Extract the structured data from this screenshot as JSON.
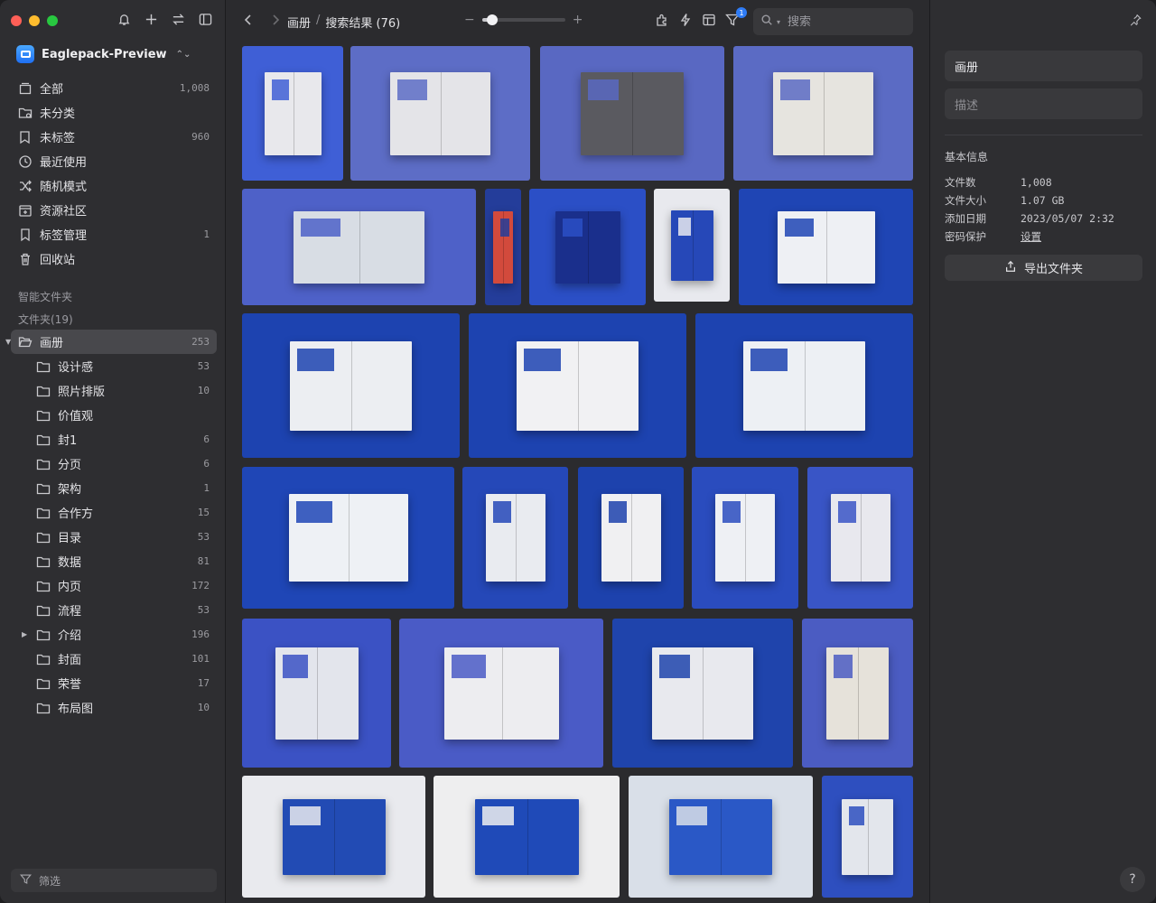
{
  "sidebar": {
    "library_name": "Eaglepack-Preview",
    "nav": [
      {
        "label": "全部",
        "count": "1,008",
        "icon": "all-items-icon"
      },
      {
        "label": "未分类",
        "count": "",
        "icon": "uncategorized-folder-icon"
      },
      {
        "label": "未标签",
        "count": "960",
        "icon": "untagged-icon"
      },
      {
        "label": "最近使用",
        "count": "",
        "icon": "clock-icon"
      },
      {
        "label": "随机模式",
        "count": "",
        "icon": "shuffle-icon"
      },
      {
        "label": "资源社区",
        "count": "",
        "icon": "community-icon"
      },
      {
        "label": "标签管理",
        "count": "1",
        "icon": "bookmark-icon"
      },
      {
        "label": "回收站",
        "count": "",
        "icon": "trash-icon"
      }
    ],
    "smart_folders_label": "智能文件夹",
    "folders_label": "文件夹(19)",
    "active_folder": {
      "label": "画册",
      "count": "253"
    },
    "subfolders": [
      {
        "label": "设计感",
        "count": "53"
      },
      {
        "label": "照片排版",
        "count": "10"
      },
      {
        "label": "价值观",
        "count": ""
      },
      {
        "label": "封1",
        "count": "6"
      },
      {
        "label": "分页",
        "count": "6"
      },
      {
        "label": "架构",
        "count": "1"
      },
      {
        "label": "合作方",
        "count": "15"
      },
      {
        "label": "目录",
        "count": "53"
      },
      {
        "label": "数据",
        "count": "81"
      },
      {
        "label": "内页",
        "count": "172"
      },
      {
        "label": "流程",
        "count": "53"
      },
      {
        "label": "介绍",
        "count": "196",
        "expandable": true
      },
      {
        "label": "封面",
        "count": "101"
      },
      {
        "label": "荣誉",
        "count": "17"
      },
      {
        "label": "布局图",
        "count": "10"
      }
    ],
    "filter_label": "筛选"
  },
  "toolbar": {
    "breadcrumb_folder": "画册",
    "breadcrumb_sep": "/",
    "breadcrumb_result": "搜索结果 (76)",
    "zoom_minus": "−",
    "zoom_plus": "+",
    "zoom_level": 0.12,
    "filter_badge": "1",
    "search_placeholder": "搜索"
  },
  "thumbnails": [
    {
      "name": "brochure-thumb-1",
      "c1": "#3f5fd6",
      "c2": "#e8e8ec"
    },
    {
      "name": "brochure-thumb-2",
      "c1": "#5d6dc6",
      "c2": "#e4e4e8"
    },
    {
      "name": "brochure-thumb-3",
      "c1": "#5968c2",
      "c2": "#5a5a60"
    },
    {
      "name": "brochure-thumb-4",
      "c1": "#5b6bc4",
      "c2": "#e6e4df"
    },
    {
      "name": "brochure-thumb-5",
      "c1": "#4e61c8",
      "c2": "#d8dde4"
    },
    {
      "name": "brochure-thumb-6",
      "c1": "#243d9a",
      "c2": "#d24a3c"
    },
    {
      "name": "brochure-thumb-7",
      "c1": "#2b4fc6",
      "c2": "#1a2f8c"
    },
    {
      "name": "brochure-thumb-8",
      "c1": "#e8e9ee",
      "c2": "#2648b8"
    },
    {
      "name": "brochure-thumb-9",
      "c1": "#1f45b4",
      "c2": "#eef0f4"
    },
    {
      "name": "brochure-thumb-10",
      "c1": "#1d43b0",
      "c2": "#eceef2"
    },
    {
      "name": "brochure-thumb-11",
      "c1": "#1d43b0",
      "c2": "#f1f1f3"
    },
    {
      "name": "brochure-thumb-12",
      "c1": "#1d43b0",
      "c2": "#edf0f4"
    },
    {
      "name": "brochure-thumb-13",
      "c1": "#1f46b6",
      "c2": "#eef1f5"
    },
    {
      "name": "brochure-thumb-14",
      "c1": "#2548b8",
      "c2": "#e9ebf0"
    },
    {
      "name": "brochure-thumb-15",
      "c1": "#1d42ad",
      "c2": "#f0f0f2"
    },
    {
      "name": "brochure-thumb-16",
      "c1": "#2a4cbe",
      "c2": "#eef0f4"
    },
    {
      "name": "brochure-thumb-17",
      "c1": "#3955c6",
      "c2": "#e8e8ee"
    },
    {
      "name": "brochure-thumb-18",
      "c1": "#3b52c4",
      "c2": "#e3e5ec"
    },
    {
      "name": "brochure-thumb-19",
      "c1": "#4a5bc6",
      "c2": "#ededf0"
    },
    {
      "name": "brochure-thumb-20",
      "c1": "#1f44ac",
      "c2": "#e8e9ee"
    },
    {
      "name": "brochure-thumb-21",
      "c1": "#4b5cc2",
      "c2": "#e6e2da"
    },
    {
      "name": "brochure-thumb-22",
      "c1": "#e9eaee",
      "c2": "#224bb4"
    },
    {
      "name": "brochure-thumb-23",
      "c1": "#eeeeef",
      "c2": "#1f4ab8"
    },
    {
      "name": "brochure-thumb-24",
      "c1": "#d9dfe8",
      "c2": "#2a58c6"
    },
    {
      "name": "brochure-thumb-25",
      "c1": "#2e4fbf",
      "c2": "#e3e6ec"
    }
  ],
  "inspector": {
    "name_value": "画册",
    "description_placeholder": "描述",
    "basic_info_title": "基本信息",
    "info": [
      {
        "key": "文件数",
        "value": "1,008"
      },
      {
        "key": "文件大小",
        "value": "1.07 GB"
      },
      {
        "key": "添加日期",
        "value": "2023/05/07 2:32"
      },
      {
        "key": "密码保护",
        "value": "设置",
        "link": true
      }
    ],
    "export_label": "导出文件夹",
    "help_label": "?"
  }
}
